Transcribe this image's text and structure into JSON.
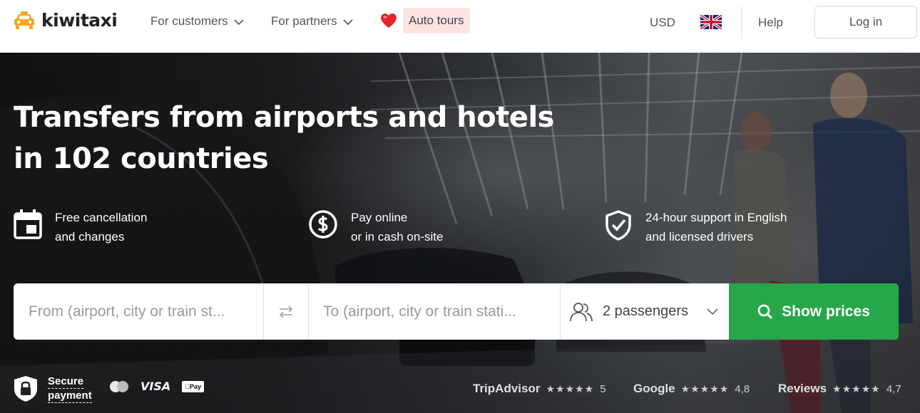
{
  "header": {
    "logo_text": "kiwitaxi",
    "nav": {
      "customers": "For customers",
      "partners": "For partners",
      "auto_tours": "Auto tours"
    },
    "currency": "USD",
    "language_icon": "uk-flag-icon",
    "help": "Help",
    "login": "Log in"
  },
  "hero": {
    "title_line1": "Transfers from airports and hotels",
    "title_line2": "in 102 countries",
    "features": [
      {
        "icon": "calendar-icon",
        "line1": "Free cancellation",
        "line2": "and changes"
      },
      {
        "icon": "dollar-icon",
        "line1": "Pay online",
        "line2": "or in cash on-site"
      },
      {
        "icon": "shield-check-icon",
        "line1": "24-hour support in English",
        "line2": "and licensed drivers"
      }
    ]
  },
  "search": {
    "from_placeholder": "From (airport, city or train st...",
    "to_placeholder": "To (airport, city or train stati...",
    "passengers": "2 passengers",
    "submit": "Show prices"
  },
  "payment": {
    "secure_line1": "Secure",
    "secure_line2": "payment",
    "visa": "VISA",
    "applepay": "Pay"
  },
  "ratings": [
    {
      "name": "TripAdvisor",
      "stars": "★★★★★",
      "value": "5"
    },
    {
      "name": "Google",
      "stars": "★★★★★",
      "value": "4,8"
    },
    {
      "name": "Reviews",
      "stars": "★★★★★",
      "value": "4,7"
    }
  ],
  "colors": {
    "brand_yellow": "#f5a623",
    "cta_green": "#27a74a",
    "auto_tours_bg": "#fde2e2"
  }
}
